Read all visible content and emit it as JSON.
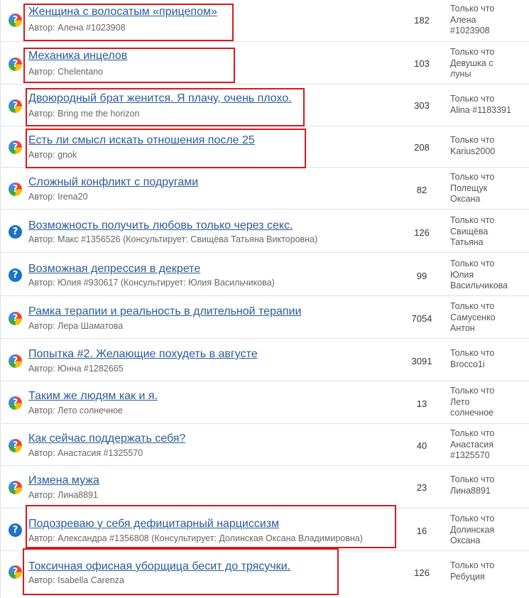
{
  "topics": [
    {
      "title": "Женщина с волосатым «прицепом»",
      "author": "Автор: Алена #1023908",
      "count": "182",
      "last": "Только что\nАлена\n#1023908",
      "icon": "multi-question-icon"
    },
    {
      "title": "Механика инцелов",
      "author": "Автор: Chelentano",
      "count": "103",
      "last": "Только что\nДевушка с\nлуны",
      "icon": "multi-question-icon"
    },
    {
      "title": "Двоюродный брат женится. Я плачу, очень плохо.",
      "author": "Автор: Bring me the horizon",
      "count": "303",
      "last": "Только что\nAlina #1183391",
      "icon": "multi-question-icon"
    },
    {
      "title": "Есть ли смысл искать отношения после 25",
      "author": "Автор: gnok",
      "count": "208",
      "last": "Только что\nKarius2000",
      "icon": "multi-question-icon"
    },
    {
      "title": "Сложный конфликт с подругами",
      "author": "Автор: Irena20",
      "count": "82",
      "last": "Только что\nПолещук\nОксана",
      "icon": "multi-question-icon"
    },
    {
      "title": "Возможность получить любовь только через секс.",
      "author": "Автор: Макс #1356526  (Консультирует: Свищёва Татьяна Викторовна)",
      "count": "126",
      "last": "Только что\nСвищёва\nТатьяна",
      "icon": "blue-question-icon"
    },
    {
      "title": "Возможная депрессия в декрете",
      "author": "Автор: Юлия #930617  (Консультирует: Юлия Васильчикова)",
      "count": "99",
      "last": "Только что\nЮлия\nВасильчикова",
      "icon": "blue-question-icon"
    },
    {
      "title": "Рамка терапии и реальность в длительной терапии",
      "author": "Автор: Лера Шаматова",
      "count": "7054",
      "last": "Только что\nСамусенко\nАнтон",
      "icon": "multi-question-icon"
    },
    {
      "title": "Попытка #2. Желающие похудеть в августе",
      "author": "Автор: Юнна #1282665",
      "count": "3091",
      "last": "Только что\nBrocco1i",
      "icon": "multi-question-icon"
    },
    {
      "title": "Таким же людям как и я.",
      "author": "Автор: Лето солнечное",
      "count": "13",
      "last": "Только что\nЛето\nсолнечное",
      "icon": "multi-question-icon"
    },
    {
      "title": "Как сейчас поддержать себя?",
      "author": "Автор: Анастасия #1325570",
      "count": "40",
      "last": "Только что\nАнастасия\n#1325570",
      "icon": "multi-question-icon"
    },
    {
      "title": "Измена мужа",
      "author": "Автор: Лина8891",
      "count": "23",
      "last": "Только что\nЛина8891",
      "icon": "multi-question-icon"
    },
    {
      "title": "Подозреваю у себя дефицитарный нарциссизм",
      "author": "Автор: Александра #1356808  (Консультирует: Долинская Оксана Владимировна)",
      "count": "16",
      "last": "Только что\nДолинская\nОксана",
      "icon": "blue-question-icon"
    },
    {
      "title": "Токсичная офисная уборщица бесит до трясучки.",
      "author": "Автор: Isabella Carenza",
      "count": "126",
      "last": "Только что\nРебуция",
      "icon": "multi-question-icon"
    }
  ],
  "colors": {
    "link": "#2a5b97",
    "highlight": "#d6191c",
    "border": "#dde2e6"
  }
}
